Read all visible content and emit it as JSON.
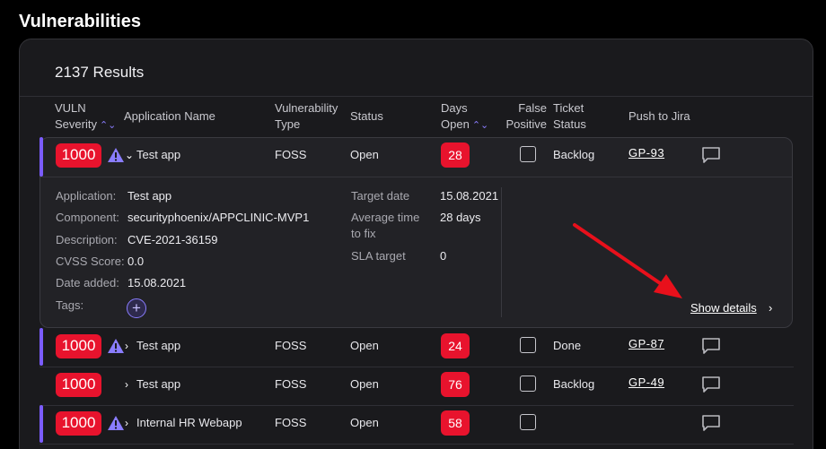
{
  "page": {
    "title": "Vulnerabilities"
  },
  "results": {
    "count_label": "2137 Results"
  },
  "columns": {
    "severity_l1": "VULN",
    "severity_l2": "Severity",
    "app_name": "Application Name",
    "vuln_type_l1": "Vulnerability",
    "vuln_type_l2": "Type",
    "status": "Status",
    "days_open_l1": "Days",
    "days_open_l2": "Open",
    "false_positive_l1": "False",
    "false_positive_l2": "Positive",
    "ticket_status_l1": "Ticket",
    "ticket_status_l2": "Status",
    "push_to_jira": "Push to Jira"
  },
  "rows": [
    {
      "severity": "1000",
      "app": "Test app",
      "type": "FOSS",
      "status": "Open",
      "days": "28",
      "ticket": "Backlog",
      "jira": "GP-93"
    },
    {
      "severity": "1000",
      "app": "Test app",
      "type": "FOSS",
      "status": "Open",
      "days": "24",
      "ticket": "Done",
      "jira": "GP-87"
    },
    {
      "severity": "1000",
      "app": "Test app",
      "type": "FOSS",
      "status": "Open",
      "days": "76",
      "ticket": "Backlog",
      "jira": "GP-49"
    },
    {
      "severity": "1000",
      "app": "Internal HR Webapp",
      "type": "FOSS",
      "status": "Open",
      "days": "58",
      "ticket": "",
      "jira": ""
    }
  ],
  "details": {
    "application_label": "Application:",
    "application_value": "Test app",
    "component_label": "Component:",
    "component_value": "securityphoenix/APPCLINIC-MVP1",
    "description_label": "Description:",
    "description_value": "CVE-2021-36159",
    "cvss_label": "CVSS Score:",
    "cvss_value": "0.0",
    "date_added_label": "Date added:",
    "date_added_value": "15.08.2021",
    "tags_label": "Tags:",
    "target_date_label": "Target date",
    "target_date_value": "15.08.2021",
    "avg_time_label_l1": "Average time",
    "avg_time_label_l2": "to fix",
    "avg_time_value": "28 days",
    "sla_label": "SLA target",
    "sla_value": "0",
    "show_details": "Show details"
  },
  "colors": {
    "severity": "#e8132d",
    "accent": "#7b5cff",
    "annotation_arrow": "#e8101b"
  }
}
